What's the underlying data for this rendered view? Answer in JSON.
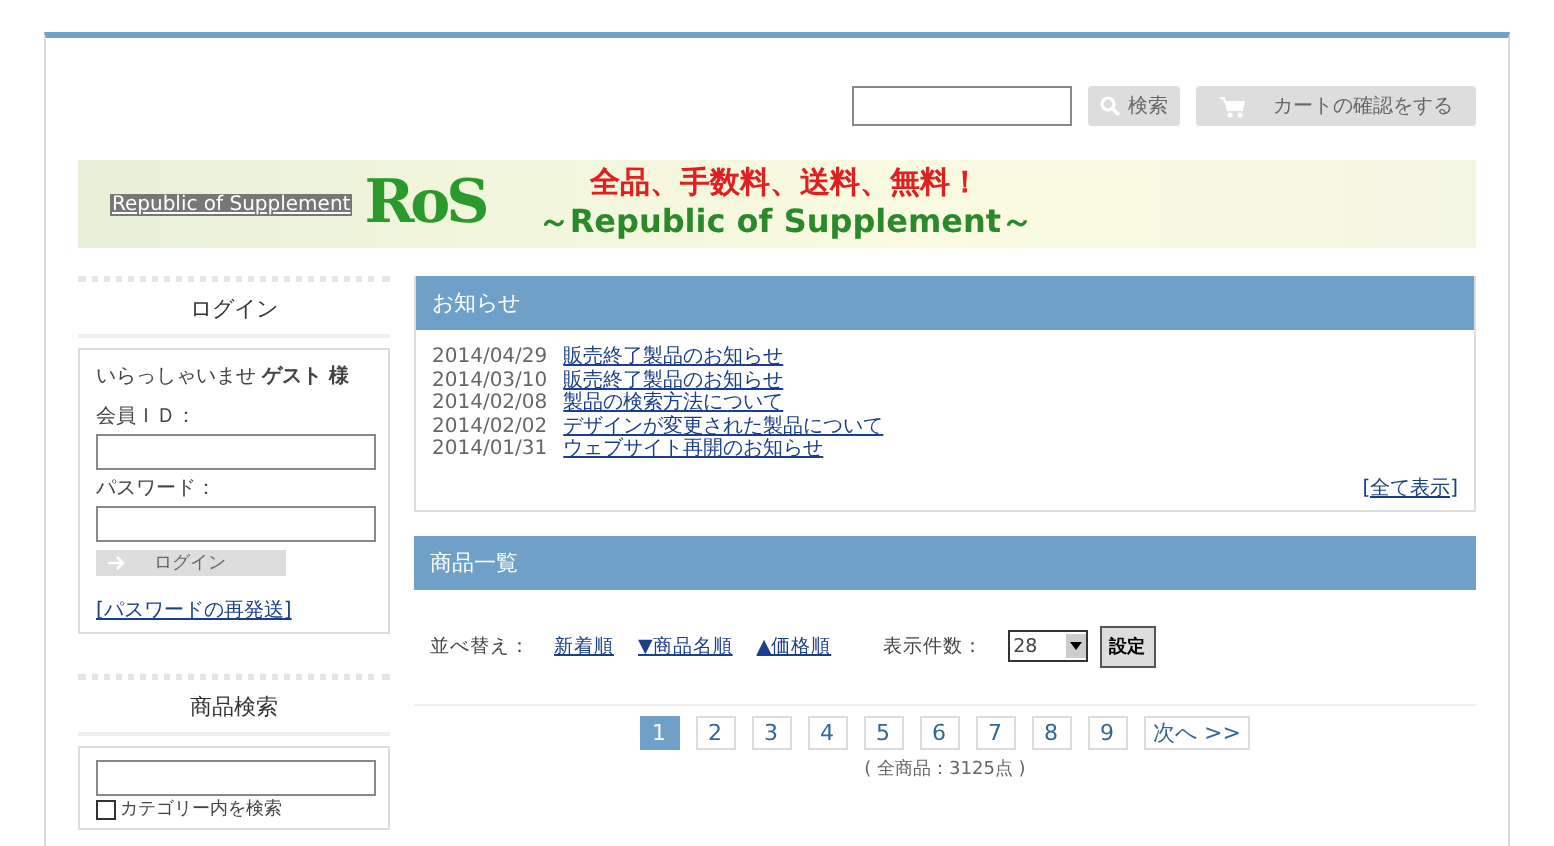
{
  "header": {
    "search_button": "検索",
    "cart_button": "カートの確認をする"
  },
  "banner": {
    "link": "Republic of Supplement",
    "logo": "RoS",
    "tagline": "全品、手数料、送料、無料！",
    "subtitle": "～Republic of Supplement～"
  },
  "login": {
    "title": "ログイン",
    "greeting": "いらっしゃいませ **ゲスト 様**",
    "id_label": "会員ＩＤ：",
    "password_label": "パスワード：",
    "button": "ログイン",
    "resend_link": "[パスワードの再発送]"
  },
  "product_search": {
    "title": "商品検索",
    "checkbox": {
      "label": "カテゴリー内を検索",
      "checked": false
    }
  },
  "news": {
    "title": "お知らせ",
    "items": [
      {
        "date": "2014/04/29",
        "title": "販売終了製品のお知らせ"
      },
      {
        "date": "2014/03/10",
        "title": "販売終了製品のお知らせ"
      },
      {
        "date": "2014/02/08",
        "title": "製品の検索方法について"
      },
      {
        "date": "2014/02/02",
        "title": "デザインが変更された製品について"
      },
      {
        "date": "2014/01/31",
        "title": "ウェブサイト再開のお知らせ"
      }
    ],
    "more": "[全て表示]"
  },
  "products": {
    "title": "商品一覧",
    "sort_label": "並べ替え：",
    "sorts": [
      "新着順",
      "▼商品名順",
      "▲価格順"
    ],
    "count_label": "表示件数：",
    "count_value": "28",
    "set_button": "設定",
    "pages": [
      {
        "label": "1",
        "selected": true
      },
      {
        "label": "2",
        "selected": false
      },
      {
        "label": "3",
        "selected": false
      },
      {
        "label": "4",
        "selected": false
      },
      {
        "label": "5",
        "selected": false
      },
      {
        "label": "6",
        "selected": false
      },
      {
        "label": "7",
        "selected": false
      },
      {
        "label": "8",
        "selected": false
      },
      {
        "label": "9",
        "selected": false
      }
    ],
    "next": "次へ >>",
    "total": "( 全商品：3125点 )"
  }
}
